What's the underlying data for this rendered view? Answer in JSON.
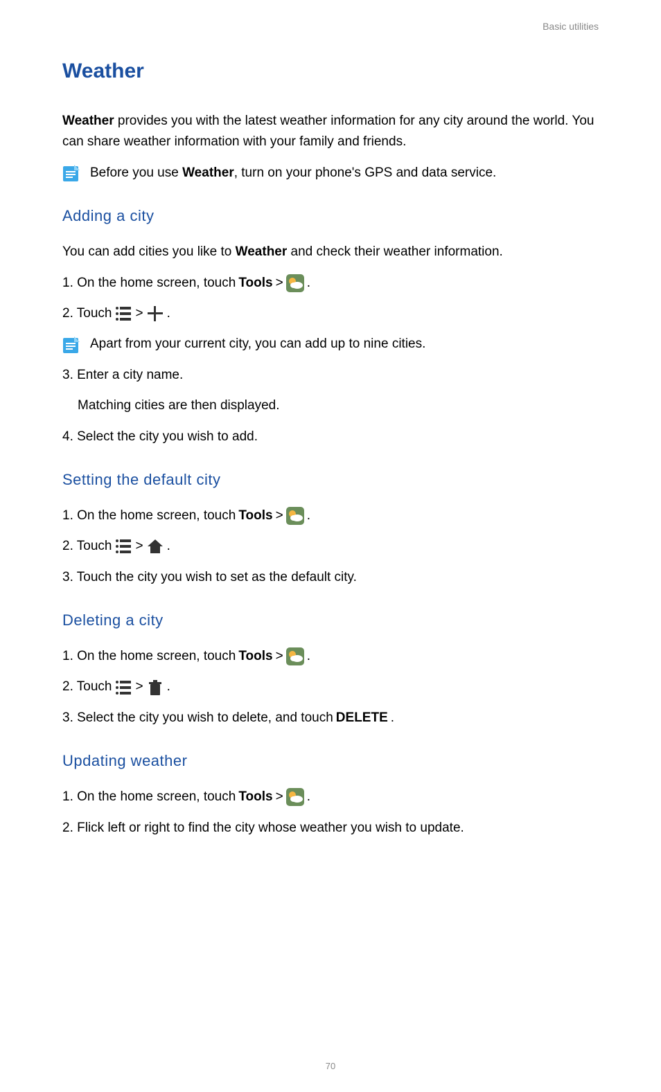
{
  "header": {
    "crumb": "Basic utilities"
  },
  "title": "Weather",
  "intro": {
    "lead_bold": "Weather",
    "lead_rest": " provides you with the latest weather information for any city around the world. You can share weather information with your family and friends."
  },
  "note1": {
    "pre": "Before you use ",
    "bold": "Weather",
    "post": ", turn on your phone's GPS and data service."
  },
  "sections": {
    "adding": {
      "heading": "Adding a city",
      "desc_pre": "You can add cities you like to ",
      "desc_bold": "Weather",
      "desc_post": " and check their weather information.",
      "step1_pre": "1. On the home screen, touch ",
      "step1_bold": "Tools",
      "step1_gt": " > ",
      "step1_period": " .",
      "step2_pre": "2. Touch ",
      "step2_gt": " > ",
      "step2_period": " .",
      "note_text": "Apart from your current city, you can add up to nine cities.",
      "step3": "3. Enter a city name.",
      "step3_sub": "Matching cities are then displayed.",
      "step4": "4. Select the city you wish to add."
    },
    "default": {
      "heading": "Setting the default city",
      "step1_pre": "1. On the home screen, touch ",
      "step1_bold": "Tools",
      "step1_gt": " > ",
      "step1_period": " .",
      "step2_pre": "2. Touch ",
      "step2_gt": " > ",
      "step2_period": " .",
      "step3": "3. Touch the city you wish to set as the default city."
    },
    "deleting": {
      "heading": "Deleting a city",
      "step1_pre": "1. On the home screen, touch ",
      "step1_bold": "Tools",
      "step1_gt": " > ",
      "step1_period": " .",
      "step2_pre": "2. Touch ",
      "step2_gt": " > ",
      "step2_period": " .",
      "step3_pre": "3. Select the city you wish to delete, and touch ",
      "step3_bold": "DELETE",
      "step3_post": "."
    },
    "updating": {
      "heading": "Updating weather",
      "step1_pre": "1. On the home screen, touch ",
      "step1_bold": "Tools",
      "step1_gt": " > ",
      "step1_period": " .",
      "step2": "2. Flick left or right to find the city whose weather you wish to update."
    }
  },
  "page_number": "70"
}
